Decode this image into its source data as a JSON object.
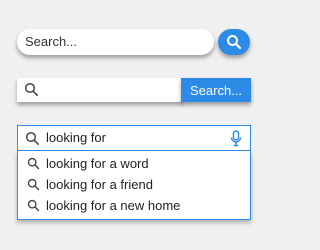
{
  "search_bar_1": {
    "placeholder": "Search...",
    "button_icon": "magnifier-icon"
  },
  "search_bar_2": {
    "icon": "magnifier-icon",
    "value": "",
    "button_label": "Search..."
  },
  "autocomplete": {
    "value": "looking for",
    "icon": "magnifier-icon",
    "mic_icon": "microphone-icon",
    "suggestions": [
      "looking for a word",
      "looking for a friend",
      "looking for a new home"
    ]
  },
  "colors": {
    "accent": "#2c8be6",
    "background": "#f0f0f0",
    "field": "#ffffff",
    "text": "#222222"
  }
}
